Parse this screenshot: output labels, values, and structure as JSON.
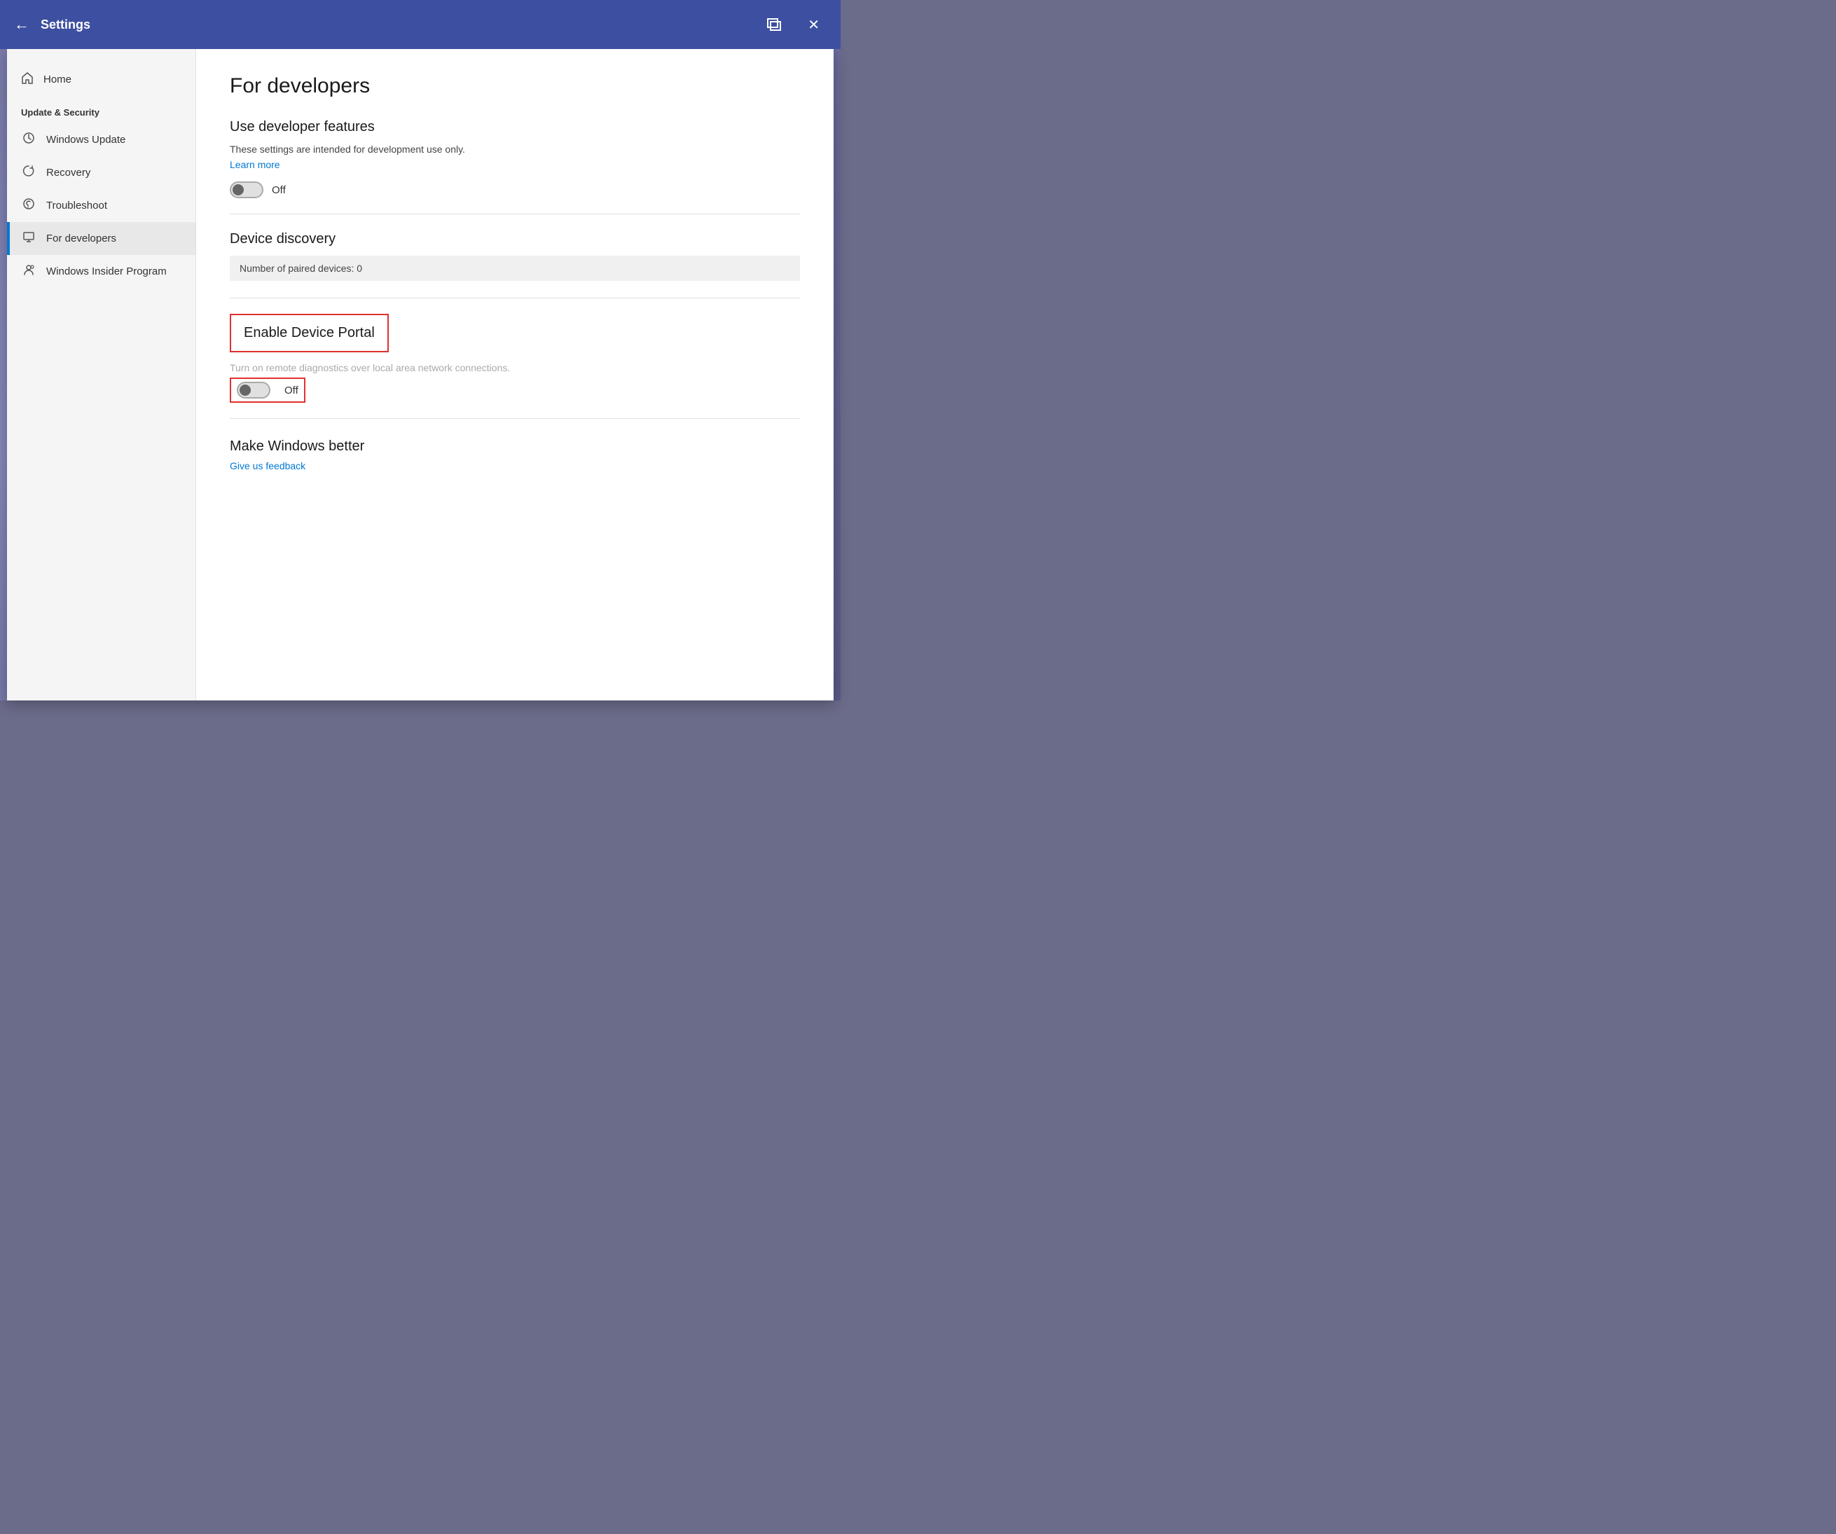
{
  "titleBar": {
    "title": "Settings",
    "backLabel": "←",
    "closeLabel": "✕"
  },
  "sidebar": {
    "homeLabel": "Home",
    "sectionTitle": "Update & Security",
    "items": [
      {
        "id": "windows-update",
        "label": "Windows Update",
        "icon": "↻"
      },
      {
        "id": "recovery",
        "label": "Recovery",
        "icon": "⟳"
      },
      {
        "id": "troubleshoot",
        "label": "Troubleshoot",
        "icon": "🔧"
      },
      {
        "id": "for-developers",
        "label": "For developers",
        "icon": "⚙",
        "active": true
      },
      {
        "id": "windows-insider",
        "label": "Windows Insider Program",
        "icon": "👤"
      }
    ]
  },
  "content": {
    "pageTitle": "For developers",
    "sections": {
      "useDeveloperFeatures": {
        "title": "Use developer features",
        "description": "These settings are intended for development use only.",
        "learnMore": "Learn more",
        "toggleLabel": "Off"
      },
      "deviceDiscovery": {
        "title": "Device discovery",
        "pairedDevices": "Number of paired devices: 0"
      },
      "enableDevicePortal": {
        "title": "Enable Device Portal",
        "description": "Turn on remote diagnostics over local area network connections.",
        "toggleLabel": "Off"
      },
      "makeWindowsBetter": {
        "title": "Make Windows better",
        "feedbackLink": "Give us feedback"
      }
    }
  }
}
